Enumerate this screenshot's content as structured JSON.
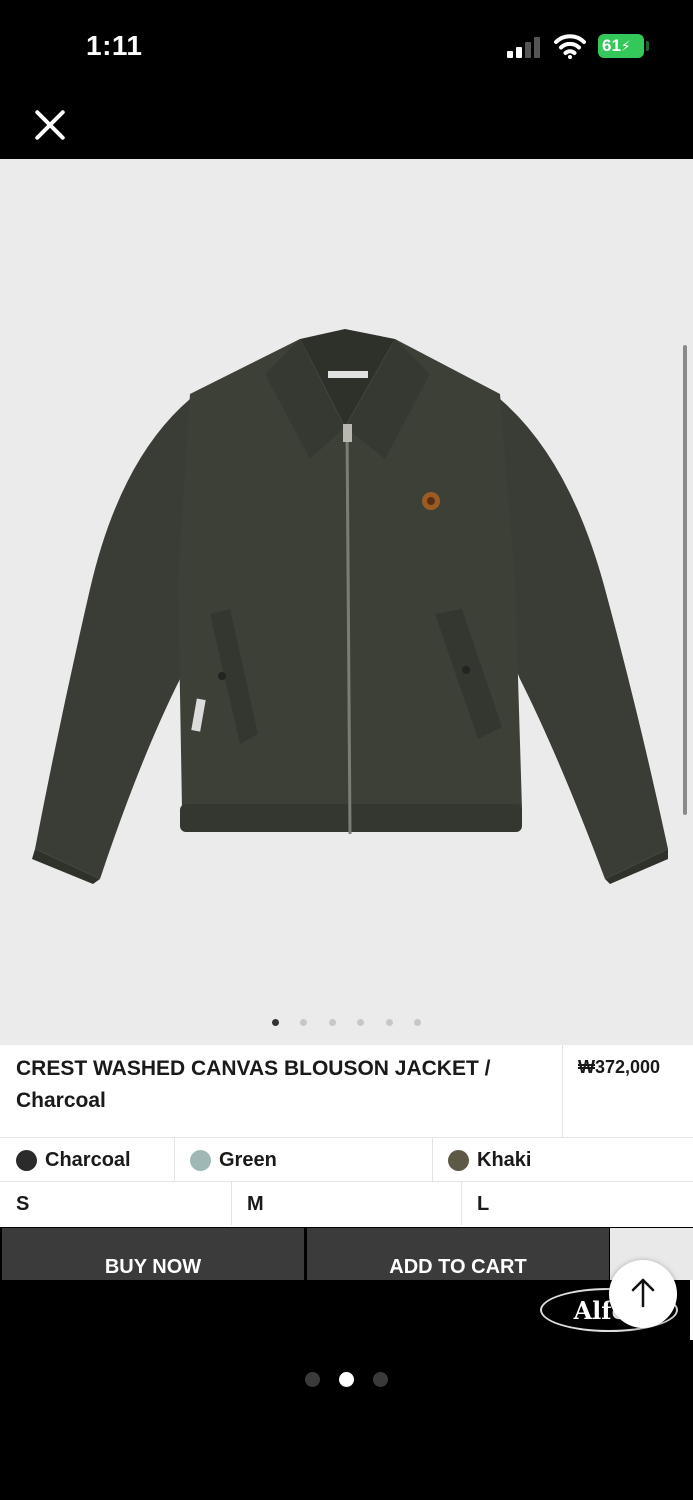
{
  "status_bar": {
    "time": "1:11",
    "battery": "61"
  },
  "gallery": {
    "image_count": 6,
    "active_index": 0
  },
  "product": {
    "title": "CREST WASHED CANVAS BLOUSON JACKET / Charcoal",
    "price": "₩372,000",
    "colors": [
      {
        "label": "Charcoal",
        "swatch": "#2b2b2b"
      },
      {
        "label": "Green",
        "swatch": "#9fb8b6"
      },
      {
        "label": "Khaki",
        "swatch": "#5e5847"
      }
    ],
    "sizes": [
      "S",
      "M",
      "L"
    ]
  },
  "actions": {
    "buy_now": "BUY NOW",
    "add_to_cart": "ADD TO CART"
  },
  "brand_logo": "Alfod",
  "story_pages": {
    "count": 3,
    "active_index": 1
  },
  "colors": {
    "jacket": "#3a3d35",
    "photo_bg": "#ebebeb",
    "button_bg": "#3b3b3b"
  }
}
